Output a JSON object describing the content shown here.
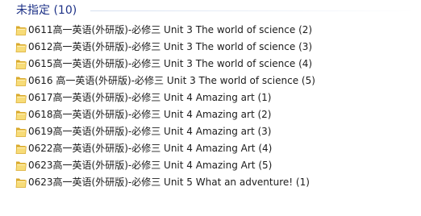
{
  "group": {
    "title": "未指定 (10)"
  },
  "items": [
    {
      "name": "0611高一英语(外研版)-必修三 Unit 3 The world of science (2)",
      "icon": "folder-icon"
    },
    {
      "name": "0612高一英语(外研版)-必修三 Unit 3 The world of science (3)",
      "icon": "folder-icon"
    },
    {
      "name": "0615高一英语(外研版)-必修三 Unit 3 The world of science (4)",
      "icon": "folder-icon"
    },
    {
      "name": "0616 高一英语(外研版)-必修三 Unit 3 The world of science (5)",
      "icon": "folder-icon"
    },
    {
      "name": "0617高一英语(外研版)-必修三 Unit 4 Amazing art (1)",
      "icon": "folder-icon"
    },
    {
      "name": "0618高一英语(外研版)-必修三 Unit 4 Amazing art (2)",
      "icon": "folder-icon"
    },
    {
      "name": "0619高一英语(外研版)-必修三 Unit 4 Amazing art (3)",
      "icon": "folder-icon"
    },
    {
      "name": "0622高一英语(外研版)-必修三 Unit 4 Amazing Art (4)",
      "icon": "folder-icon"
    },
    {
      "name": "0623高一英语(外研版)-必修三 Unit 4 Amazing Art (5)",
      "icon": "folder-icon"
    },
    {
      "name": "0623高一英语(外研版)-必修三 Unit 5 What an adventure! (1)",
      "icon": "folder-icon"
    }
  ],
  "colors": {
    "group_title": "#1e3287",
    "text": "#1b1b1b",
    "folder_light": "#f7dc78",
    "folder_dark": "#d9a92c"
  }
}
